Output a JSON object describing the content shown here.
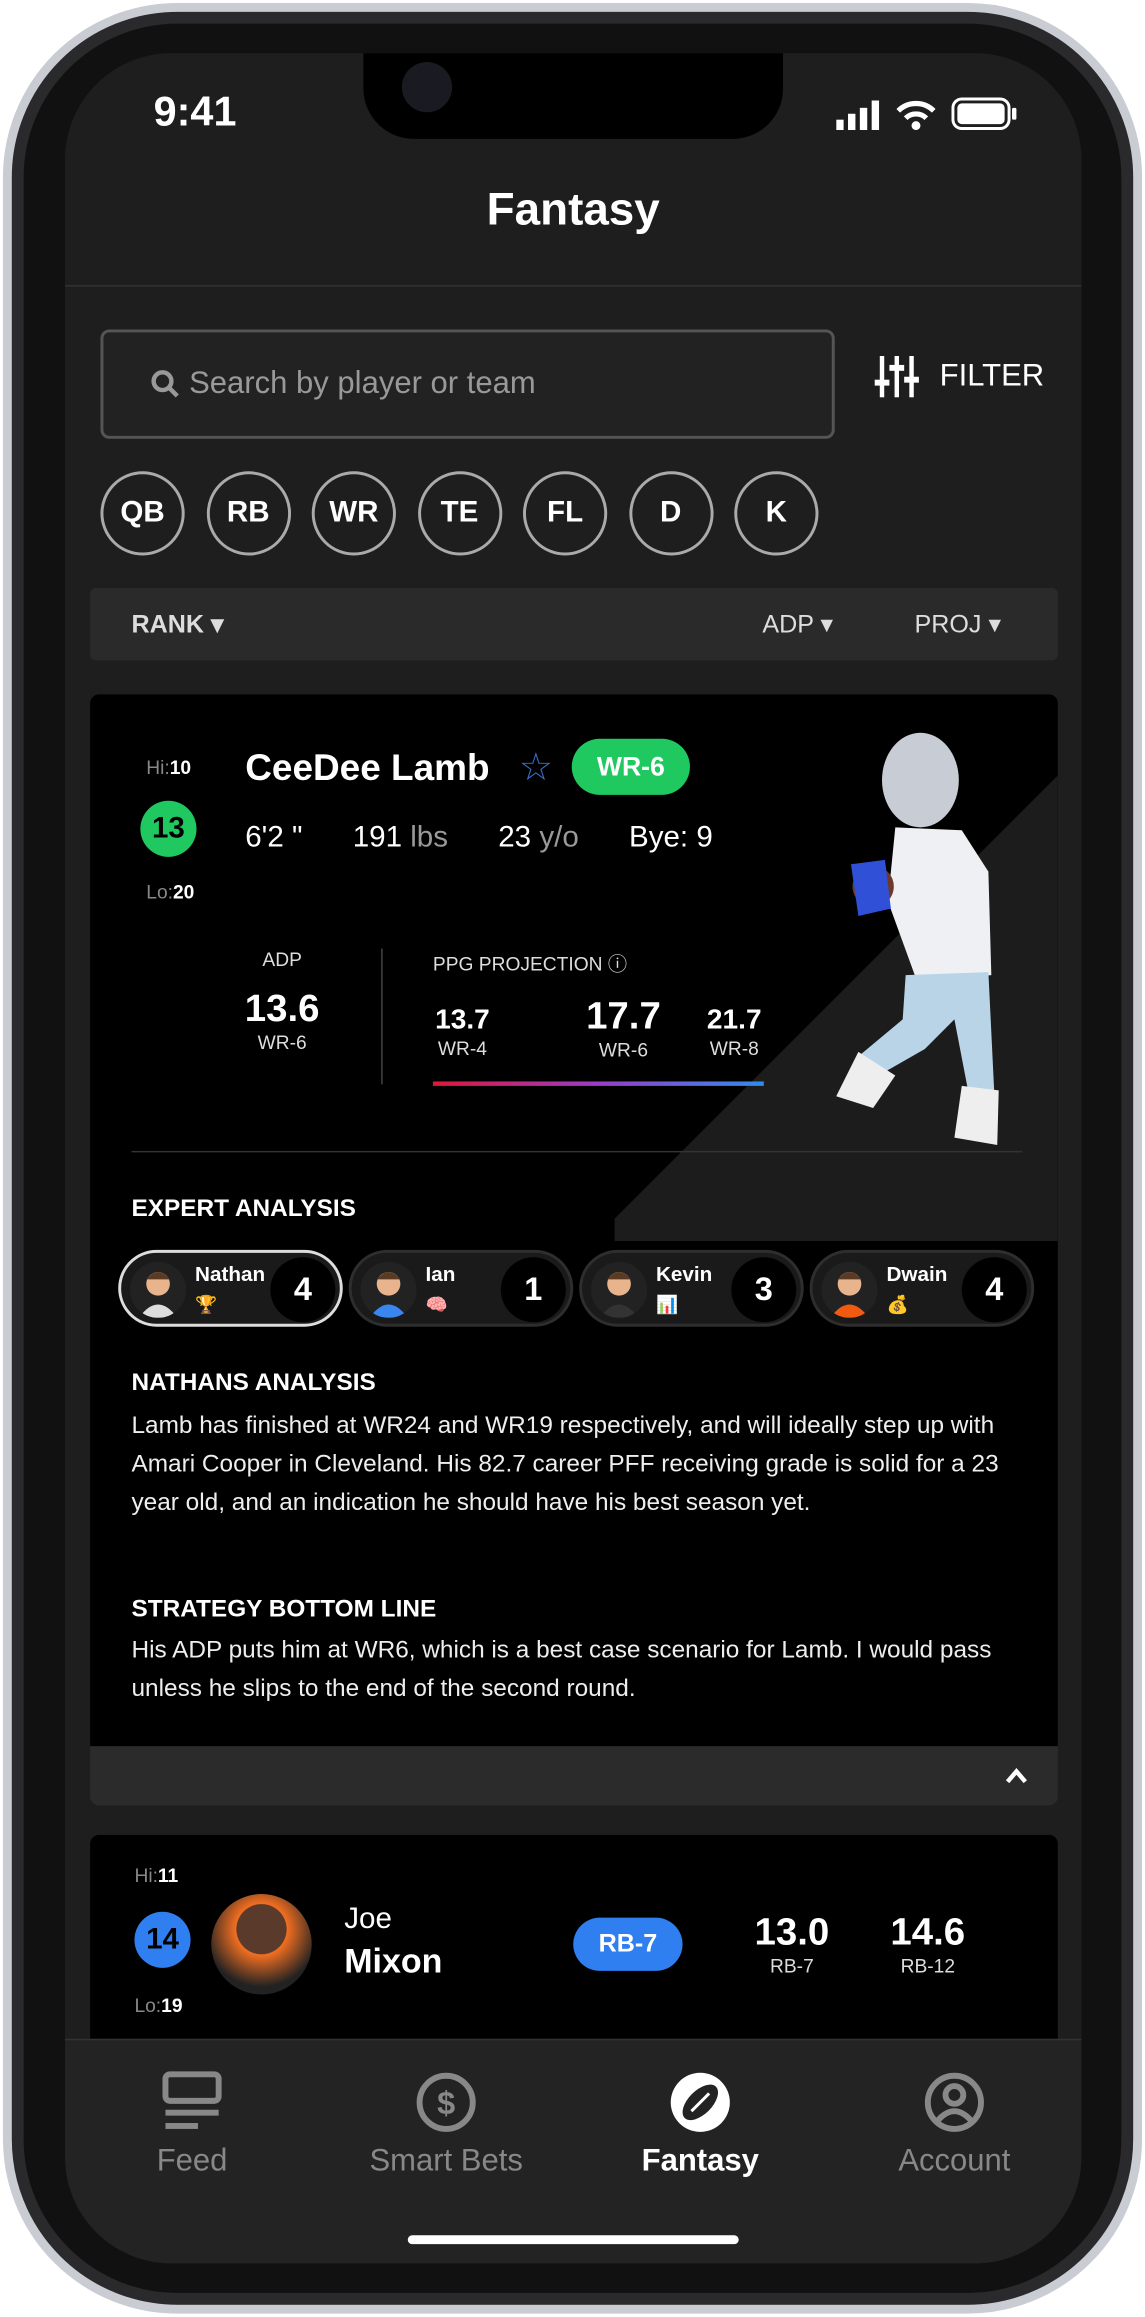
{
  "status": {
    "time": "9:41"
  },
  "header": {
    "title": "Fantasy"
  },
  "search": {
    "placeholder": "Search by player or team"
  },
  "filter": {
    "label": "FILTER"
  },
  "positions": [
    "QB",
    "RB",
    "WR",
    "TE",
    "FL",
    "D",
    "K"
  ],
  "sort": {
    "rank": "RANK",
    "adp": "ADP",
    "proj": "PROJ"
  },
  "player1": {
    "hi_label": "Hi:",
    "hi": "10",
    "rank": "13",
    "lo_label": "Lo:",
    "lo": "20",
    "name": "CeeDee Lamb",
    "position_badge": "WR-6",
    "badge_color": "#1fc95f",
    "height": "6'2 \"",
    "weight": "191",
    "weight_unit": "lbs",
    "age": "23",
    "age_unit": "y/o",
    "bye": "Bye: 9",
    "adp_label": "ADP",
    "adp": "13.6",
    "adp_rank": "WR-6",
    "proj_label": "PPG PROJECTION",
    "proj": [
      {
        "value": "13.7",
        "rank": "WR-4"
      },
      {
        "value": "17.7",
        "rank": "WR-6"
      },
      {
        "value": "21.7",
        "rank": "WR-8"
      }
    ],
    "expert_title": "EXPERT ANALYSIS",
    "experts": [
      {
        "name": "Nathan",
        "badge": "🏆",
        "count": "4",
        "shirt": "#ddd"
      },
      {
        "name": "Ian",
        "badge": "🧠",
        "count": "1",
        "shirt": "#3a86f0"
      },
      {
        "name": "Kevin",
        "badge": "📊",
        "count": "3",
        "shirt": "#333"
      },
      {
        "name": "Dwain",
        "badge": "💰",
        "count": "4",
        "shirt": "#f25a10"
      }
    ],
    "analysis_title": "NATHANS ANALYSIS",
    "analysis": "Lamb has finished at WR24 and WR19 respectively, and will ideally step up with Amari Cooper in Cleveland. His 82.7 career PFF receiving grade is solid for a 23 year old, and an indication he should have his best season yet.",
    "bottom_title": "STRATEGY BOTTOM LINE",
    "bottom": "His ADP puts him at WR6, which is a best case scenario for Lamb. I would pass unless he slips to the end of the second round."
  },
  "player2": {
    "hi_label": "Hi:",
    "hi": "11",
    "rank": "14",
    "lo_label": "Lo:",
    "lo": "19",
    "first": "Joe",
    "last": "Mixon",
    "position_badge": "RB-7",
    "badge_color": "#2f7ff0",
    "adp": "13.0",
    "adp_rank": "RB-7",
    "proj": "14.6",
    "proj_rank": "RB-12"
  },
  "tabs": [
    {
      "label": "Feed",
      "icon": "feed-icon"
    },
    {
      "label": "Smart Bets",
      "icon": "dollar-icon"
    },
    {
      "label": "Fantasy",
      "icon": "football-icon",
      "active": true
    },
    {
      "label": "Account",
      "icon": "account-icon"
    }
  ]
}
